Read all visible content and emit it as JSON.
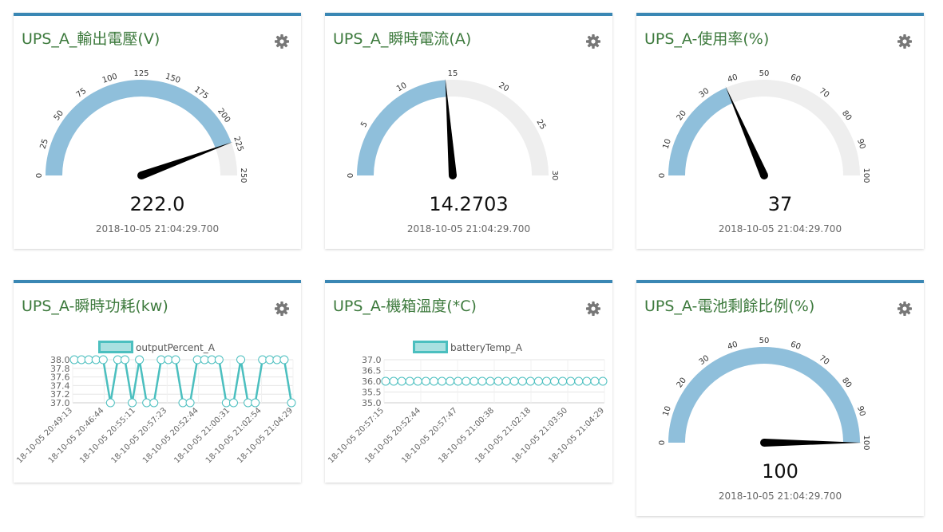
{
  "timestamp": "2018-10-05 21:04:29.700",
  "colors": {
    "accent": "#3a87b4",
    "title": "#3d7a3d",
    "gauge_fill": "#8fbfdb",
    "gauge_bg": "#eeeeee",
    "line": "#4bbfbf"
  },
  "icons": {
    "settings": "gear-icon"
  },
  "cards": [
    {
      "title": "UPS_A_輸出電壓(V)",
      "type": "gauge",
      "min": 0,
      "max": 250,
      "ticks": [
        "0",
        "25",
        "50",
        "75",
        "100",
        "125",
        "150",
        "175",
        "200",
        "225",
        "250"
      ],
      "value": 222.0,
      "value_text": "222.0",
      "timestamp": "2018-10-05 21:04:29.700"
    },
    {
      "title": "UPS_A_瞬時電流(A)",
      "type": "gauge",
      "min": 0,
      "max": 30,
      "ticks": [
        "0",
        "5",
        "10",
        "15",
        "20",
        "25",
        "30"
      ],
      "value": 14.2703,
      "value_text": "14.2703",
      "timestamp": "2018-10-05 21:04:29.700"
    },
    {
      "title": "UPS_A-使用率(%)",
      "type": "gauge",
      "min": 0,
      "max": 100,
      "ticks": [
        "0",
        "10",
        "20",
        "30",
        "40",
        "50",
        "60",
        "70",
        "80",
        "90",
        "100"
      ],
      "value": 37,
      "value_text": "37",
      "timestamp": "2018-10-05 21:04:29.700"
    },
    {
      "title": "UPS_A-瞬時功耗(kw)",
      "type": "line"
    },
    {
      "title": "UPS_A-機箱溫度(*C)",
      "type": "line"
    },
    {
      "title": "UPS_A-電池剩餘比例(%)",
      "type": "gauge",
      "min": 0,
      "max": 100,
      "ticks": [
        "0",
        "10",
        "20",
        "30",
        "40",
        "50",
        "60",
        "70",
        "80",
        "90",
        "100"
      ],
      "value": 100,
      "value_text": "100",
      "timestamp": "2018-10-05 21:04:29.700"
    }
  ],
  "chart_data": [
    {
      "type": "line",
      "legend": "outputPercent_A",
      "ylim": [
        37.0,
        38.0
      ],
      "yticks": [
        "38.0",
        "37.8",
        "37.6",
        "37.4",
        "37.2",
        "37.0"
      ],
      "xticks": [
        "18-10-05 20:49:13",
        "18-10-05 20:46:44",
        "18-10-05 20:55:11",
        "18-10-05 20:57:23",
        "18-10-05 20:52:44",
        "18-10-05 21:00:31",
        "18-10-05 21:02:54",
        "18-10-05 21:04:29"
      ],
      "values": [
        38,
        38,
        38,
        38,
        38,
        37,
        38,
        38,
        37,
        38,
        37,
        37,
        38,
        38,
        38,
        37,
        37,
        38,
        38,
        38,
        38,
        37,
        37,
        38,
        37,
        37,
        38,
        38,
        38,
        38,
        37
      ]
    },
    {
      "type": "line",
      "legend": "batteryTemp_A",
      "ylim": [
        35.0,
        37.0
      ],
      "yticks": [
        "37.0",
        "36.5",
        "36.0",
        "35.5",
        "35.0"
      ],
      "xticks": [
        "18-10-05 20:57:15",
        "18-10-05 20:52:44",
        "18-10-05 20:57:47",
        "18-10-05 21:00:38",
        "18-10-05 21:02:18",
        "18-10-05 21:03:50",
        "18-10-05 21:04:29"
      ],
      "values": [
        36,
        36,
        36,
        36,
        36,
        36,
        36,
        36,
        36,
        36,
        36,
        36,
        36,
        36,
        36,
        36,
        36,
        36,
        36,
        36,
        36,
        36,
        36,
        36,
        36,
        36,
        36,
        36
      ]
    }
  ]
}
